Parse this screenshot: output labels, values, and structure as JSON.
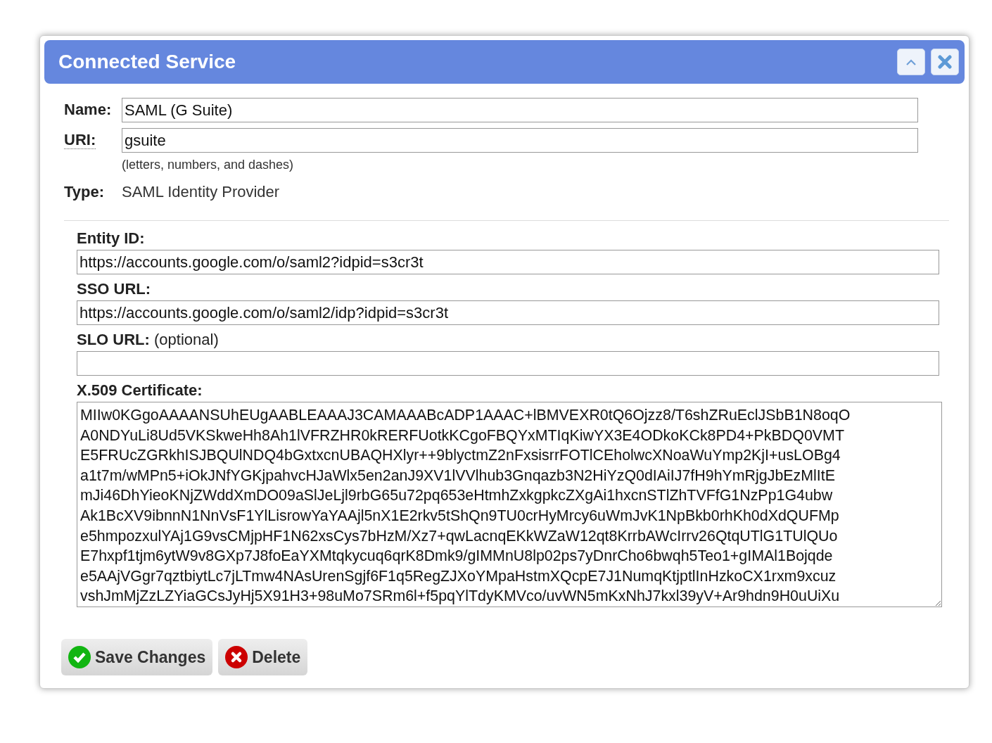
{
  "dialog": {
    "title": "Connected Service",
    "header_buttons": [
      {
        "kind": "collapse"
      },
      {
        "kind": "close"
      }
    ]
  },
  "fields": [
    {
      "label": "Name:",
      "value": "SAML (G Suite)",
      "dotted": false
    },
    {
      "label": "URI:",
      "value": "gsuite",
      "dotted": true,
      "hint": "(letters, numbers, and dashes)"
    }
  ],
  "type": {
    "label": "Type:",
    "value": "SAML Identity Provider"
  },
  "saml": [
    {
      "label": "Entity ID:",
      "value": "https://accounts.google.com/o/saml2?idpid=s3cr3t"
    },
    {
      "label": "SSO URL:",
      "value": "https://accounts.google.com/o/saml2/idp?idpid=s3cr3t"
    },
    {
      "label": "SLO URL:",
      "note": "(optional)"
    }
  ],
  "certificate": {
    "label": "X.509 Certificate:",
    "lines": [
      "MIIw0KGgoAAAANSUhEUgAABLEAAAJ3CAMAAABcADP1AAAC+lBMVEXR0tQ6Ojzz8/T6shZRuEclJSbB1N8oqO",
      "A0NDYuLi8Ud5VKSkweHh8Ah1lVFRZHR0kRERFUotkKCgoFBQYxMTIqKiwYX3E4ODkoKCk8PD4+PkBDQ0VMT",
      "E5FRUcZGRkhISJBQUlNDQ4bGxtxcnUBAQHXlyr++9blyctmZ2nFxsisrrFOTlCEholwcXNoaWuYmp2KjI+usLOBg4",
      "a1t7m/wMPn5+iOkJNfYGKjpahvcHJaWlx5en2anJ9XV1lVVlhub3Gnqazb3N2HiYzQ0dIAiIJ7fH9hYmRjgJbEzMlItE",
      "mJi46DhYieoKNjZWddXmDO09aSlJeLjl9rbG65u72pq653eHtmhZxkgpkcZXgAi1hxcnSTlZhTVFfG1NzPp1G4ubw",
      "Ak1BcXV9ibnnN1NnVsF1YlLisrowYaYAAjl5nX1E2rkv5tShQn9TU0crHyMrcy6uWmJvK1NpBkb0rhKh0dXdQUFMp",
      "e5hmpozxulYAj1G9vsCMjpHF1N62xsCys7bHzM/Xz7+qwLacnqEKkWZaW12qt8KrrbAWcIrrv26QtqUTlG1TUlQUo",
      "E7hxpf1tjm6ytW9v8GXp7J8foEaYXMtqkycuq6qrK8Dmk9/gIMMnU8lp02ps7yDnrCho6bwqh5Teo1+gIMAl1Bojqde",
      "e5AAjVGgr7qztbiytLc7jLTmw4NAsUrenSgjf6F1q5RegZJXoYMpaHstmXQcpE7J1NumqKtjptlInHzkoCX1rxm9xcuz",
      "vshJmMjZzLZYiaGCsJyHj5X91H3+98uMo7SRm6l+f5pqYlTdyKMVco/uvWN5mKxNhJ7kxl39yV+Ar9hdn9H0uUiXu"
    ]
  },
  "buttons": [
    {
      "kind": "save",
      "label": "Save Changes"
    },
    {
      "kind": "delete",
      "label": "Delete"
    }
  ]
}
